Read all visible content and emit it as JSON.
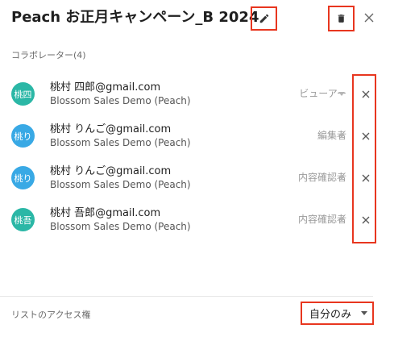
{
  "header": {
    "title": "Peach お正月キャンペーン_B 2024",
    "edit_icon": "pencil-icon",
    "delete_icon": "trash-icon",
    "close_icon": "close-icon"
  },
  "collaborators": {
    "section_label": "コラボレーター(4)",
    "items": [
      {
        "avatar": "桃四",
        "avatar_color": "#2bb7a6",
        "email": "桃村 四郎@gmail.com",
        "org": "Blossom Sales Demo (Peach)",
        "role": "ビューアー"
      },
      {
        "avatar": "桃り",
        "avatar_color": "#39a9e5",
        "email": "桃村 りんご@gmail.com",
        "org": "Blossom Sales Demo (Peach)",
        "role": "編集者"
      },
      {
        "avatar": "桃り",
        "avatar_color": "#39a9e5",
        "email": "桃村 りんご@gmail.com",
        "org": "Blossom Sales Demo (Peach)",
        "role": "内容確認者"
      },
      {
        "avatar": "桃吾",
        "avatar_color": "#2bb7a6",
        "email": "桃村 吾郎@gmail.com",
        "org": "Blossom Sales Demo (Peach)",
        "role": "内容確認者"
      }
    ]
  },
  "footer": {
    "access_label": "リストのアクセス権",
    "access_value": "自分のみ"
  },
  "colors": {
    "highlight": "#e8361f",
    "teal_avatar": "#2bb7a6",
    "blue_avatar": "#39a9e5"
  }
}
